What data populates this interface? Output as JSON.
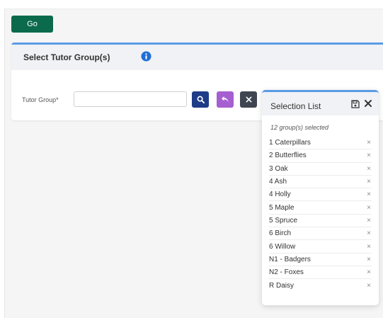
{
  "toolbar": {
    "go_label": "Go"
  },
  "panel": {
    "title": "Select Tutor Group(s)",
    "field_label": "Tutor Group*",
    "input_value": "",
    "input_placeholder": ""
  },
  "selection": {
    "title": "Selection List",
    "count_text": "12 group(s) selected",
    "items": [
      "1 Caterpillars",
      "2 Butterflies",
      "3 Oak",
      "4 Ash",
      "4 Holly",
      "5 Maple",
      "5 Spruce",
      "6 Birch",
      "6 Willow",
      "N1 - Badgers",
      "N2 - Foxes",
      "R Daisy"
    ],
    "remove_glyph": "×"
  },
  "colors": {
    "go_button": "#0b6a4b",
    "accent_border": "#5b9be6",
    "search_button": "#1f3c88",
    "undo_button": "#a55fd0",
    "clear_button": "#3f4652",
    "info_icon": "#1f6fd6"
  },
  "icons": {
    "info": "info-circle-icon",
    "search": "search-icon",
    "undo": "undo-arrow-icon",
    "clear": "close-icon",
    "save": "save-icon",
    "close": "close-icon",
    "remove": "remove-x-icon"
  }
}
